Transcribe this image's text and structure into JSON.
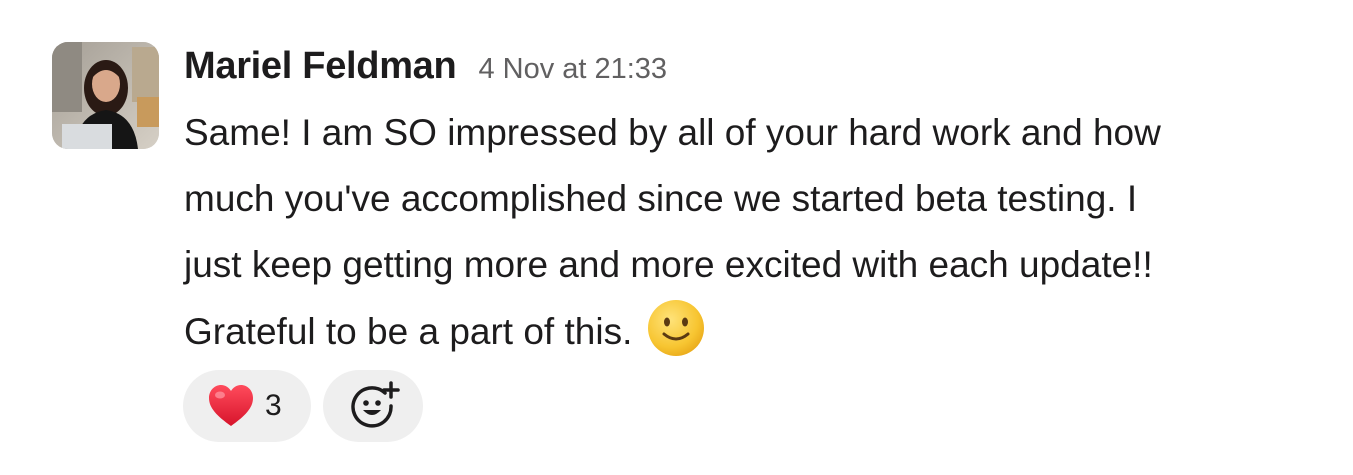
{
  "message": {
    "sender": "Mariel Feldman",
    "timestamp": "4 Nov at 21:33",
    "lines": [
      "Same! I am SO impressed by all of your hard work and how",
      "much you've accomplished since we started beta testing. I",
      "just keep getting more and more excited with each update!!",
      "Grateful to be a part of this."
    ],
    "inline_emoji": "slightly-smiling-face-icon"
  },
  "reactions": [
    {
      "icon": "red-heart-icon",
      "count": "3"
    },
    {
      "icon": "add-reaction-icon"
    }
  ],
  "colors": {
    "text": "#1d1c1d",
    "muted": "#616061",
    "reaction_bg": "#efefef",
    "heart": "#e0245e",
    "emoji_yellow": "#f7c531"
  }
}
